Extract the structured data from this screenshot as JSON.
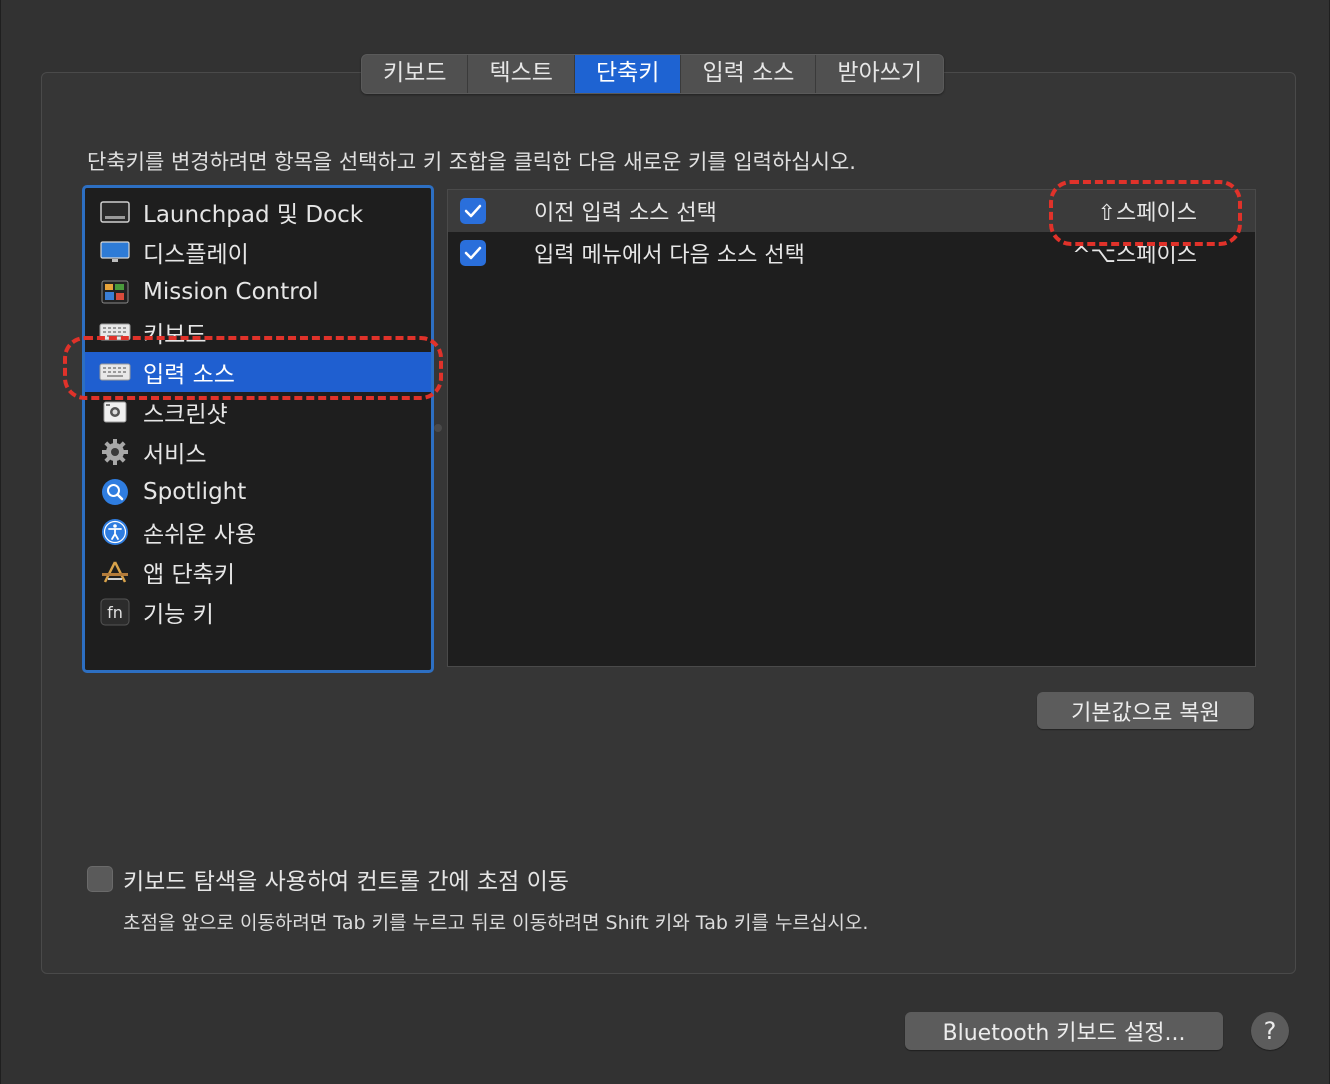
{
  "tabs": [
    {
      "label": "키보드"
    },
    {
      "label": "텍스트"
    },
    {
      "label": "단축키",
      "active": true
    },
    {
      "label": "입력 소스"
    },
    {
      "label": "받아쓰기"
    }
  ],
  "instruction": "단축키를 변경하려면 항목을 선택하고 키 조합을 클릭한 다음 새로운 키를 입력하십시오.",
  "sidebar": {
    "items": [
      {
        "label": "Launchpad 및 Dock",
        "icon": "launchpad-dock-icon"
      },
      {
        "label": "디스플레이",
        "icon": "display-icon"
      },
      {
        "label": "Mission Control",
        "icon": "mission-control-icon"
      },
      {
        "label": "키보드",
        "icon": "keyboard-icon"
      },
      {
        "label": "입력 소스",
        "icon": "input-source-icon",
        "selected": true
      },
      {
        "label": "스크린샷",
        "icon": "screenshot-icon"
      },
      {
        "label": "서비스",
        "icon": "gear-icon"
      },
      {
        "label": "Spotlight",
        "icon": "spotlight-icon"
      },
      {
        "label": "손쉬운 사용",
        "icon": "accessibility-icon"
      },
      {
        "label": "앱 단축키",
        "icon": "app-shortcuts-icon"
      },
      {
        "label": "기능 키",
        "icon": "fn-key-icon"
      }
    ]
  },
  "shortcuts": [
    {
      "label": "이전 입력 소스 선택",
      "shortcut": "⇧스페이스",
      "checked": true
    },
    {
      "label": "입력 메뉴에서 다음 소스 선택",
      "shortcut": "^⌥스페이스",
      "checked": true
    }
  ],
  "restore_button": "기본값으로 복원",
  "keyboard_nav": {
    "label": "키보드 탐색을 사용하여 컨트롤 간에 초점 이동",
    "checked": false,
    "hint": "초점을 앞으로 이동하려면 Tab 키를 누르고 뒤로 이동하려면 Shift 키와 Tab 키를 누르십시오."
  },
  "bluetooth_button": "Bluetooth 키보드 설정...",
  "help_button": "?",
  "colors": {
    "accent": "#1f5fd0",
    "annotation": "#e0322a"
  }
}
